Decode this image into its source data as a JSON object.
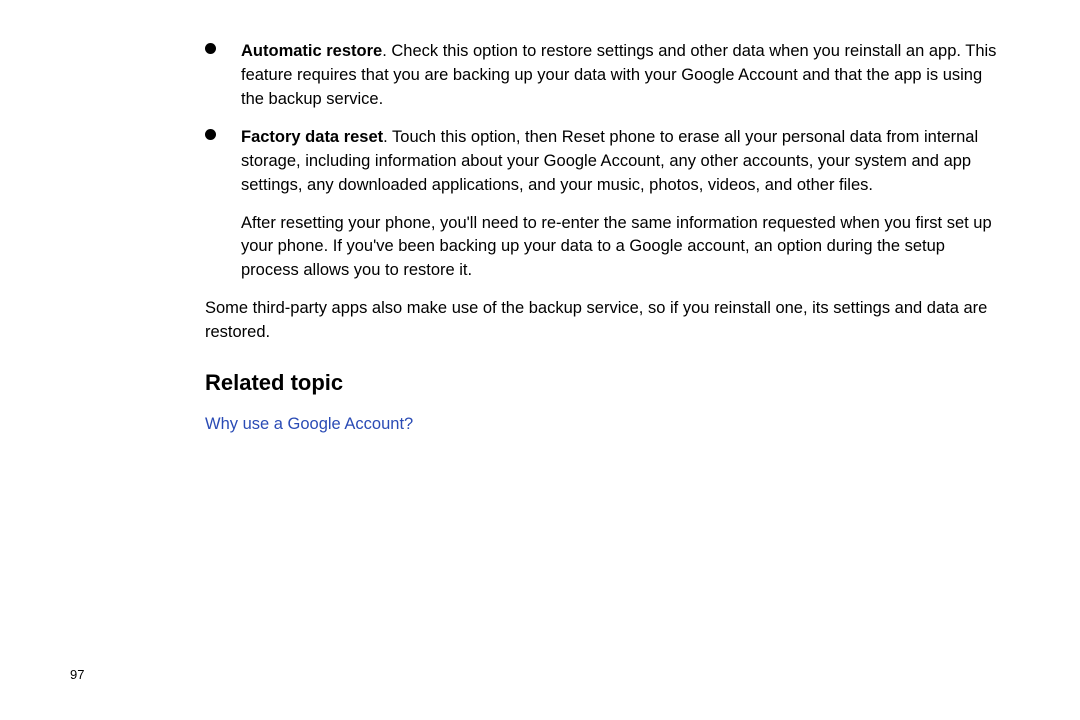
{
  "bullets": [
    {
      "title": "Automatic restore",
      "text": ". Check this option to restore settings and other data when you reinstall an app. This feature requires that you are backing up your data with your Google Account and that the app is using the backup service."
    },
    {
      "title": "Factory data reset",
      "text": ". Touch this option, then Reset phone to erase all your personal data from internal storage, including information about your Google Account, any other accounts, your system and app settings, any downloaded applications, and your music, photos, videos, and other files."
    }
  ],
  "continuation": "After resetting your phone, you'll need to re-enter the same information requested when you first set up your phone. If you've been backing up your data to a Google account, an option during the setup process allows you to restore it.",
  "plain": "Some third-party apps also make use of the backup service, so if you reinstall one, its settings and data are restored.",
  "heading": "Related topic",
  "link": "Why use a Google Account?",
  "page_number": "97"
}
